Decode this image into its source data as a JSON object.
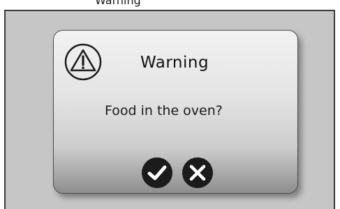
{
  "header": {
    "label": "Warning"
  },
  "dialog": {
    "icon": "warning-triangle-icon",
    "title": "Warning",
    "message": "Food in the oven?",
    "buttons": [
      {
        "icon": "checkmark-icon",
        "action": "confirm"
      },
      {
        "icon": "close-icon",
        "action": "cancel"
      }
    ]
  },
  "colors": {
    "screen_background": "#c6c6c6",
    "dialog_gradient_top": "#f2f2f2",
    "dialog_gradient_bottom": "#8e8e8e",
    "button_fill": "#1b1b1b"
  }
}
